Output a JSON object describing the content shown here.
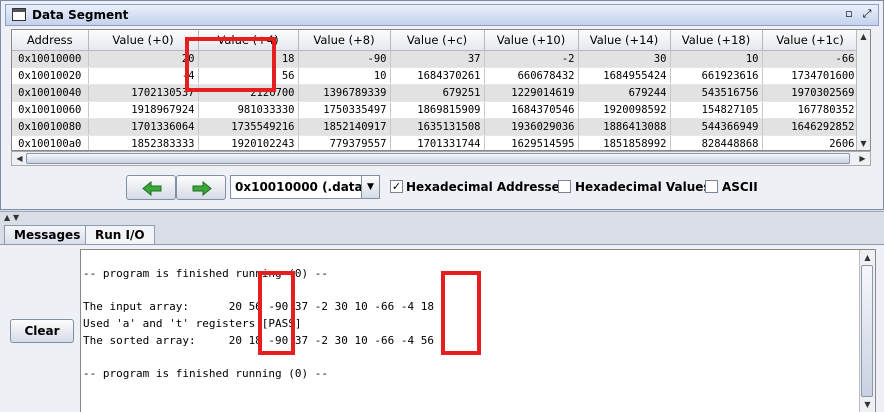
{
  "data_segment": {
    "title": "Data Segment",
    "columns": [
      "Address",
      "Value (+0)",
      "Value (+4)",
      "Value (+8)",
      "Value (+c)",
      "Value (+10)",
      "Value (+14)",
      "Value (+18)",
      "Value (+1c)"
    ],
    "rows": [
      [
        "0x10010000",
        "20",
        "18",
        "-90",
        "37",
        "-2",
        "30",
        "10",
        "-66"
      ],
      [
        "0x10010020",
        "-4",
        "56",
        "10",
        "1684370261",
        "660678432",
        "1684955424",
        "661923616",
        "1734701600"
      ],
      [
        "0x10010040",
        "1702130537",
        "2126700",
        "1396789339",
        "679251",
        "1229014619",
        "679244",
        "543516756",
        "1970302569"
      ],
      [
        "0x10010060",
        "1918967924",
        "981033330",
        "1750335497",
        "1869815909",
        "1684370546",
        "1920098592",
        "154827105",
        "167780352"
      ],
      [
        "0x10010080",
        "1701336064",
        "1735549216",
        "1852140917",
        "1635131508",
        "1936029036",
        "1886413088",
        "544366949",
        "1646292852"
      ],
      [
        "0x100100a0",
        "1852383333",
        "1920102243",
        "779379557",
        "1701331744",
        "1629514595",
        "1851858992",
        "828448868",
        "2606"
      ]
    ]
  },
  "controls": {
    "segment_selector": "0x10010000 (.data)",
    "hex_addresses_label": "Hexadecimal Addresses",
    "hex_addresses_checked": true,
    "hex_values_label": "Hexadecimal Values",
    "hex_values_checked": false,
    "ascii_label": "ASCII",
    "ascii_checked": false
  },
  "messages": {
    "tabs": [
      "Messages",
      "Run I/O"
    ],
    "active_tab": "Run I/O",
    "clear_label": "Clear",
    "lines": [
      "-- program is finished running (0) --",
      "",
      "The input array:      20 56 -90 37 -2 30 10 -66 -4 18",
      "Used 'a' and 't' registers [PASS]",
      "The sorted array:     20 18 -90 37 -2 30 10 -66 -4 56",
      "",
      "-- program is finished running (0) --"
    ]
  },
  "colors": {
    "highlight": "#e61e1e",
    "titlebar": "#c4d2ec",
    "arrow_green": "#3aa83a"
  },
  "icons": {
    "left": "green-left-arrow-icon",
    "right": "green-right-arrow-icon"
  }
}
